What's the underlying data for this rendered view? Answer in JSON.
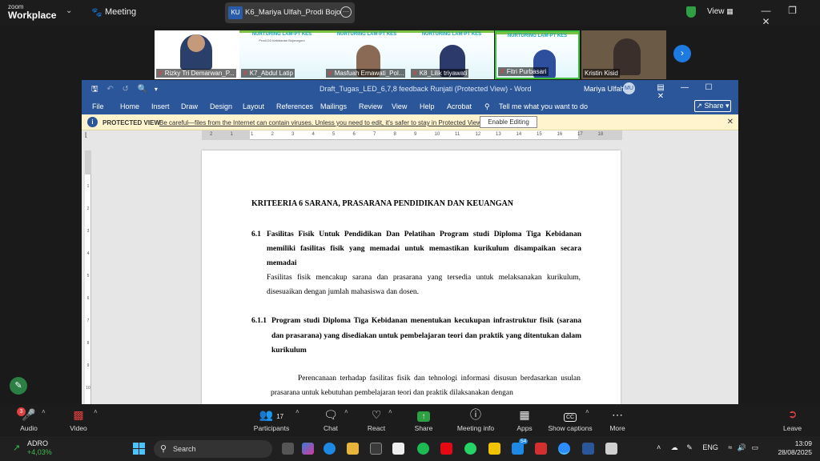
{
  "zoom": {
    "logo_small": "zoom",
    "logo_big": "Workplace",
    "meeting_label": "Meeting",
    "tab_badge": "KU",
    "tab_title": "K6_Mariya Ulfah_Prodi Bojonegoro",
    "view_label": "View"
  },
  "participants": [
    {
      "name": "Rizky Tri Demarwan_P..."
    },
    {
      "name": "K7_Abdul Latip"
    },
    {
      "name": "Masfuah Ernawati_Pol..."
    },
    {
      "name": "K8_Lilik triyawati"
    },
    {
      "name": "Fitri Purbasari"
    },
    {
      "name": "Kristin Kisid"
    }
  ],
  "slide": {
    "heading": "NURTURING LAM-PT KES",
    "sub": "Prodi D3 Kebidanan Bojonegoro"
  },
  "word": {
    "doc_title": "Draft_Tugas_LED_6,7,8 feedback Runjati (Protected View)  -  Word",
    "user": "Mariya Ulfah",
    "user_initials": "MU",
    "menu": [
      "File",
      "Home",
      "Insert",
      "Draw",
      "Design",
      "Layout",
      "References",
      "Mailings",
      "Review",
      "View",
      "Help",
      "Acrobat"
    ],
    "tell_me": "Tell me what you want to do",
    "share": "Share",
    "protected_label": "PROTECTED VIEW",
    "protected_msg": "Be careful—files from the Internet can contain viruses. Unless you need to edit, it's safer to stay in Protected View.",
    "enable_editing": "Enable Editing",
    "ruler_marks": [
      "2",
      "1",
      "1",
      "2",
      "3",
      "4",
      "5",
      "6",
      "7",
      "8",
      "9",
      "10",
      "11",
      "12",
      "13",
      "14",
      "15",
      "16",
      "17",
      "18"
    ],
    "vruler_marks": [
      "1",
      "2",
      "3",
      "4",
      "5",
      "6",
      "7",
      "8",
      "9",
      "10"
    ]
  },
  "document": {
    "heading": "KRITEERIA 6 SARANA, PRASARANA PENDIDIKAN DAN KEUANGAN",
    "s61_num": "6.1",
    "s61_title": "Fasilitas Fisik Untuk Pendidikan Dan Pelatihan Program studi Diploma Tiga Kebidanan memiliki fasilitas fisik yang memadai untuk memastikan kurikulum disampaikan secara memadai",
    "s61_body": "Fasilitas fisik mencakup sarana dan prasarana yang tersedia untuk melaksanakan kurikulum, disesuaikan dengan jumlah mahasiswa dan dosen.",
    "s611_num": "6.1.1",
    "s611_title": "Program studi Diploma Tiga Kebidanan menentukan kecukupan infrastruktur fisik (sarana dan prasarana) yang disediakan untuk pembelajaran teori dan praktik yang ditentukan dalam kurikulum",
    "s611_body": "Perencanaan terhadap fasilitas fisik dan tehnologi informasi disusun berdasarkan usulan   prasarana untuk kebutuhan pembelajaran teori dan praktik dilaksanakan dengan"
  },
  "controls": {
    "audio": "Audio",
    "audio_badge": "3",
    "video": "Video",
    "participants": "Participants",
    "participants_count": "17",
    "chat": "Chat",
    "react": "React",
    "share": "Share",
    "meeting_info": "Meeting info",
    "apps": "Apps",
    "show_captions": "Show captions",
    "more": "More",
    "leave": "Leave",
    "cc": "CC"
  },
  "taskbar": {
    "stock_name": "ADRO",
    "stock_change": "+4,03%",
    "search": "Search",
    "badge": "54",
    "lang": "ENG",
    "time": "13:09",
    "date": "28/08/2025"
  },
  "colors": {
    "word_blue": "#2b579a",
    "zoom_blue": "#1c7ae0",
    "protected_bg": "#fff4ce",
    "slide_teal": "#17a3b8"
  }
}
